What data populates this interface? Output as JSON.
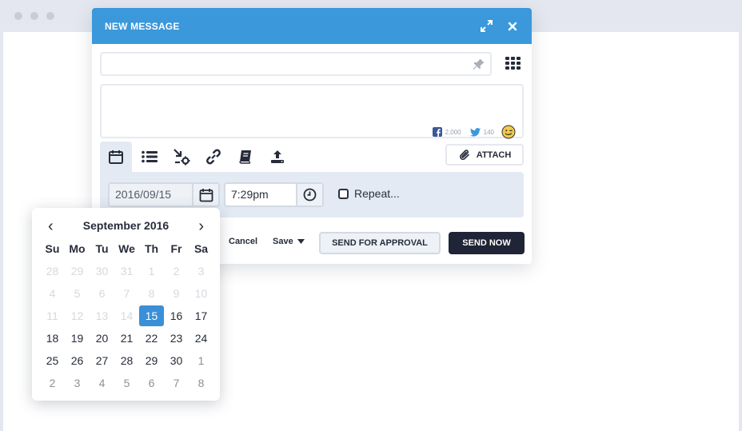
{
  "compose": {
    "title": "NEW MESSAGE",
    "recipient_value": "",
    "message_value": "",
    "facebook_count": "2,000",
    "twitter_count": "140"
  },
  "toolbar": {
    "attach_label": "ATTACH"
  },
  "schedule": {
    "date_value": "2016/09/15",
    "time_value": "7:29pm",
    "repeat_label": "Repeat..."
  },
  "footer": {
    "cancel_label": "Cancel",
    "save_label": "Save",
    "approval_label": "SEND FOR APPROVAL",
    "send_now_label": "SEND NOW"
  },
  "datepicker": {
    "prev_label": "‹",
    "next_label": "›",
    "month_label": "September 2016",
    "weekdays": [
      "Su",
      "Mo",
      "Tu",
      "We",
      "Th",
      "Fr",
      "Sa"
    ],
    "days": [
      {
        "d": "28",
        "s": "muted"
      },
      {
        "d": "29",
        "s": "muted"
      },
      {
        "d": "30",
        "s": "muted"
      },
      {
        "d": "31",
        "s": "muted"
      },
      {
        "d": "1",
        "s": "muted"
      },
      {
        "d": "2",
        "s": "muted"
      },
      {
        "d": "3",
        "s": "muted"
      },
      {
        "d": "4",
        "s": "muted"
      },
      {
        "d": "5",
        "s": "muted"
      },
      {
        "d": "6",
        "s": "muted"
      },
      {
        "d": "7",
        "s": "muted"
      },
      {
        "d": "8",
        "s": "muted"
      },
      {
        "d": "9",
        "s": "muted"
      },
      {
        "d": "10",
        "s": "muted"
      },
      {
        "d": "11",
        "s": "muted"
      },
      {
        "d": "12",
        "s": "muted"
      },
      {
        "d": "13",
        "s": "muted"
      },
      {
        "d": "14",
        "s": "muted"
      },
      {
        "d": "15",
        "s": "selected"
      },
      {
        "d": "16",
        "s": "normal"
      },
      {
        "d": "17",
        "s": "normal"
      },
      {
        "d": "18",
        "s": "normal"
      },
      {
        "d": "19",
        "s": "normal"
      },
      {
        "d": "20",
        "s": "normal"
      },
      {
        "d": "21",
        "s": "normal"
      },
      {
        "d": "22",
        "s": "normal"
      },
      {
        "d": "23",
        "s": "normal"
      },
      {
        "d": "24",
        "s": "normal"
      },
      {
        "d": "25",
        "s": "normal"
      },
      {
        "d": "26",
        "s": "normal"
      },
      {
        "d": "27",
        "s": "normal"
      },
      {
        "d": "28",
        "s": "normal"
      },
      {
        "d": "29",
        "s": "normal"
      },
      {
        "d": "30",
        "s": "normal"
      },
      {
        "d": "1",
        "s": "other"
      },
      {
        "d": "2",
        "s": "other"
      },
      {
        "d": "3",
        "s": "other"
      },
      {
        "d": "4",
        "s": "other"
      },
      {
        "d": "5",
        "s": "other"
      },
      {
        "d": "6",
        "s": "other"
      },
      {
        "d": "7",
        "s": "other"
      },
      {
        "d": "8",
        "s": "other"
      }
    ]
  },
  "colors": {
    "header_blue": "#3a98db",
    "selected_day": "#3a8fd6",
    "send_now_bg": "#1f2436",
    "panel_bg": "#e3eaf3"
  },
  "icons": [
    "expand-icon",
    "close-icon",
    "pin-icon",
    "grid-icon",
    "facebook-icon",
    "twitter-icon",
    "emoji-icon",
    "calendar-icon",
    "list-icon",
    "settings-icon",
    "link-icon",
    "book-icon",
    "upload-icon",
    "paperclip-icon",
    "clock-icon",
    "caret-down-icon"
  ]
}
